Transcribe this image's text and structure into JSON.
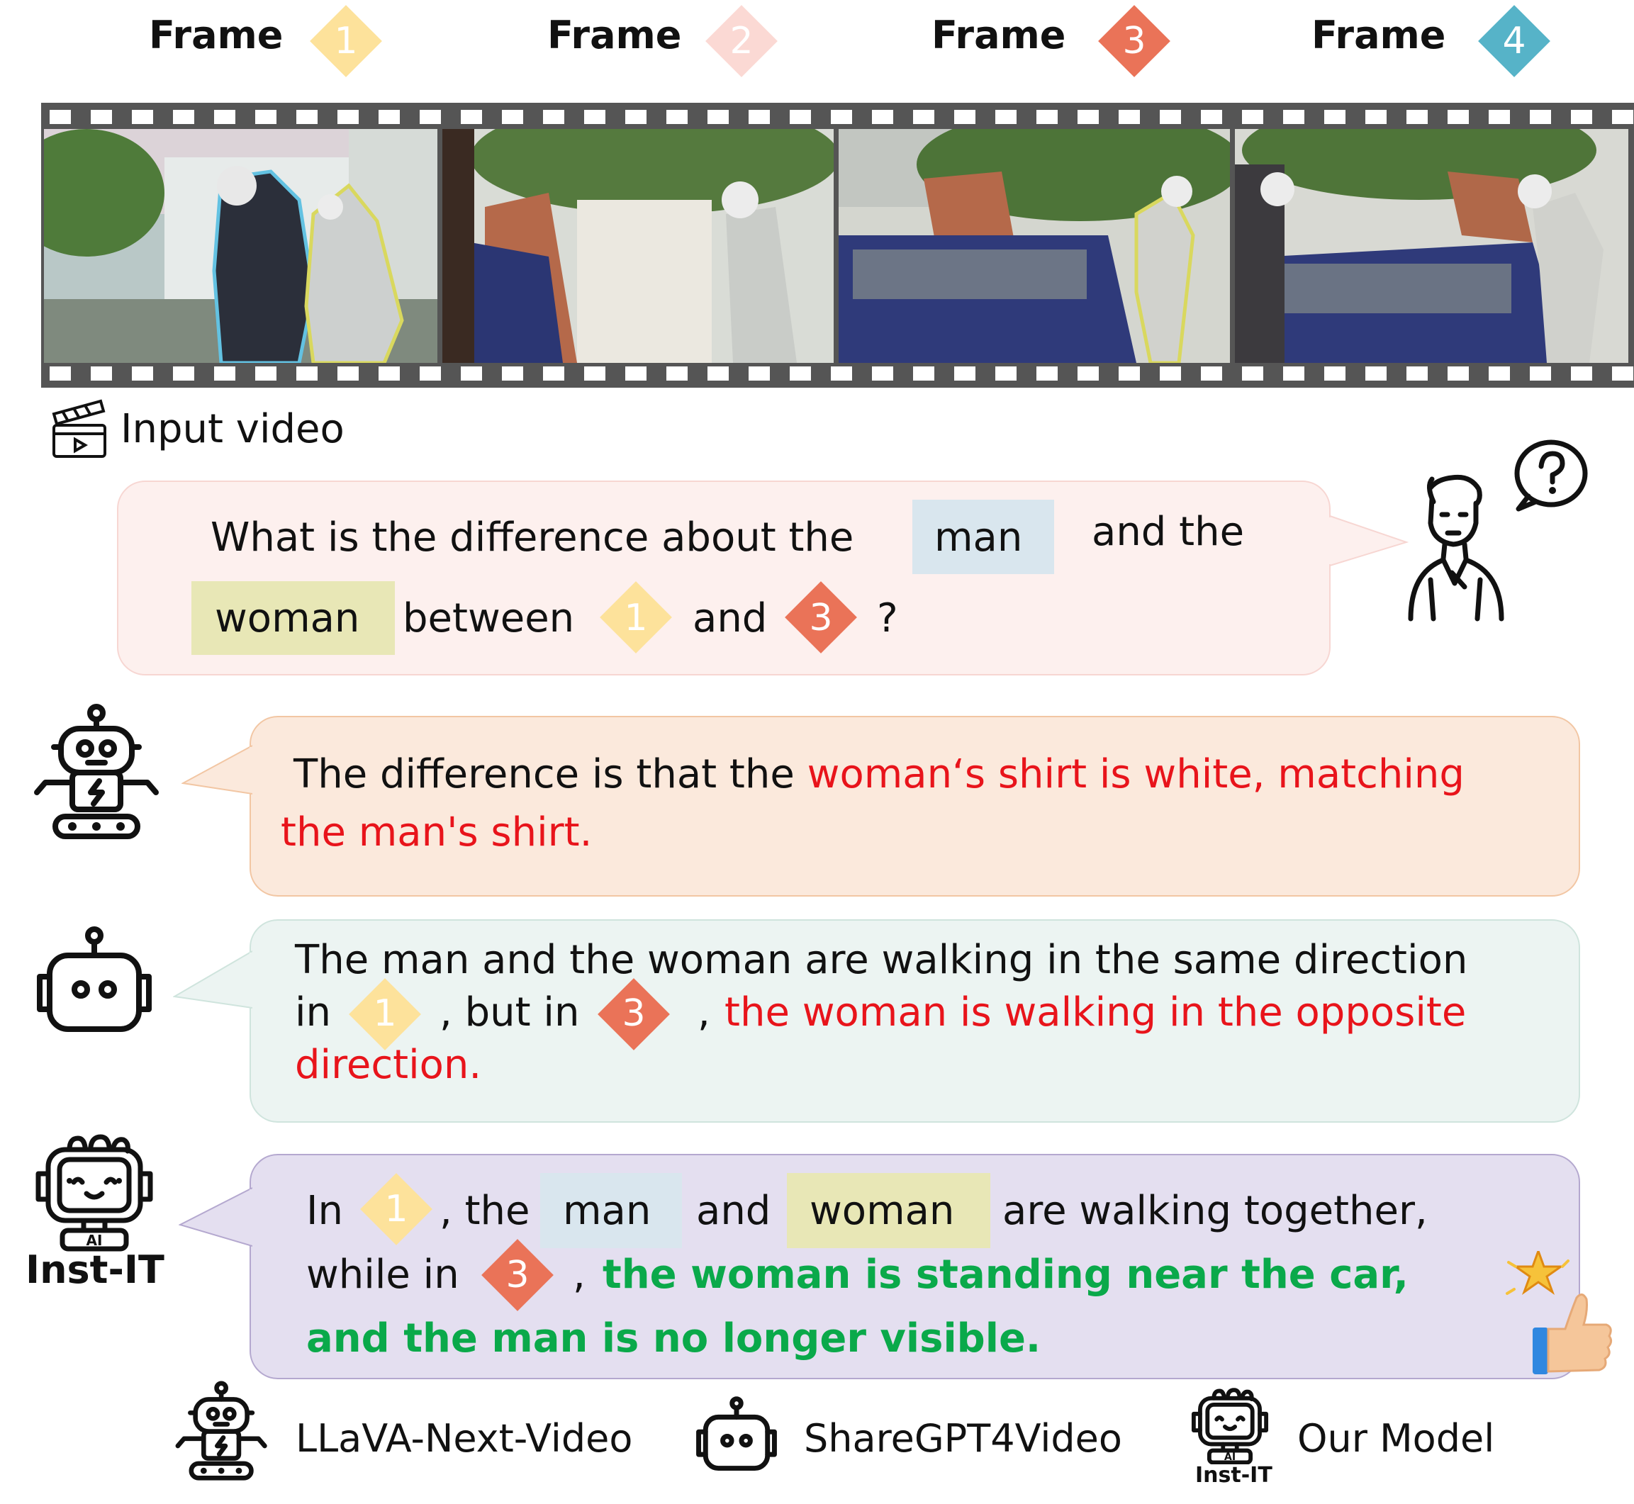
{
  "frames": {
    "label": "Frame",
    "items": [
      {
        "num": "1",
        "color": "#fde29b"
      },
      {
        "num": "2",
        "color": "#fbd9d4"
      },
      {
        "num": "3",
        "color": "#ea7358"
      },
      {
        "num": "4",
        "color": "#56b3c8"
      }
    ]
  },
  "input_video_label": "Input video",
  "question": {
    "line1_a": "What is the difference about the",
    "man": "man",
    "line1_b": "and the",
    "woman": "woman",
    "between": "between",
    "f1": "1",
    "and": "and",
    "f3": "3",
    "qmark": "?"
  },
  "answer1": {
    "line1_plain": "The difference is that the",
    "line1_red": "woman‘s shirt is white, matching",
    "line2_red": "the man's shirt."
  },
  "answer2": {
    "line1": "The man and the woman are walking in the same direction",
    "in": "in",
    "f1": "1",
    "but_in": ", but in",
    "f3": "3",
    "comma": ",",
    "line2_red": "the woman is walking in the opposite",
    "line3_red": "direction."
  },
  "answer3": {
    "in": "In",
    "f1": "1",
    "the": ", the",
    "man": "man",
    "and": "and",
    "woman": "woman",
    "rest1": "are walking together,",
    "while_in": "while in",
    "f3": "3",
    "comma": ",",
    "green1": "the woman is standing near the car,",
    "green2": "and the man is no longer visible."
  },
  "brand": "Inst-IT",
  "icon_ai_text": "AI",
  "legend": {
    "items": [
      {
        "label": "LLaVA-Next-Video",
        "icon": "robot-tracked-icon"
      },
      {
        "label": "ShareGPT4Video",
        "icon": "robot-head-icon"
      },
      {
        "label": "Our Model",
        "icon": "inst-it-robot-icon"
      }
    ],
    "brand": "Inst-IT"
  },
  "colors": {
    "frame1": "#fde29b",
    "frame2": "#fbd9d4",
    "frame3": "#ea7358",
    "frame4": "#56b3c8",
    "question_bg": "#fdf0ee",
    "answer1_bg": "#fbe9dc",
    "answer2_bg": "#ecf4f2",
    "answer3_bg": "#e4dff0",
    "wrong": "#e8141b",
    "correct": "#0aa94a"
  }
}
